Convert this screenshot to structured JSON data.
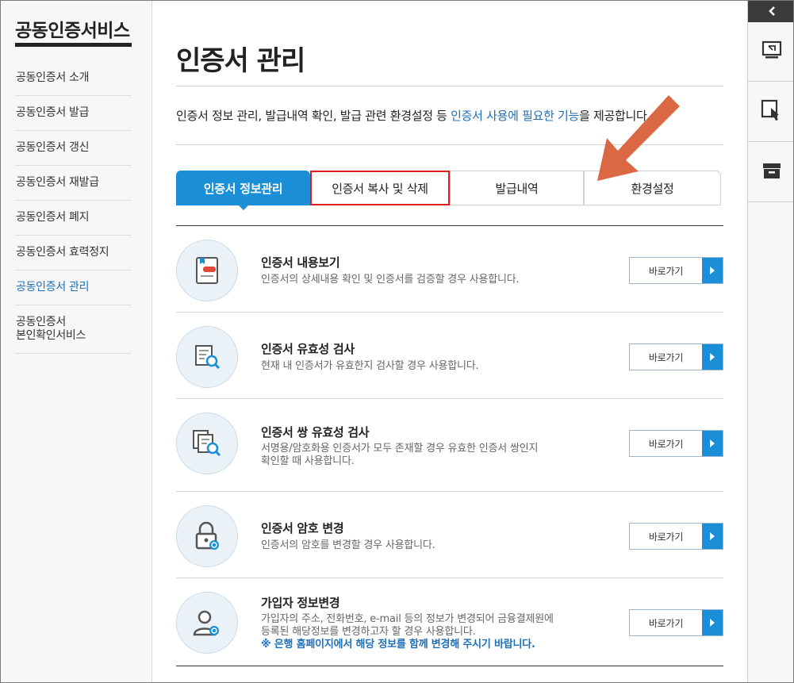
{
  "sidebar": {
    "title": "공동인증서비스",
    "items": [
      {
        "label": "공동인증서 소개",
        "active": false
      },
      {
        "label": "공동인증서 발급",
        "active": false
      },
      {
        "label": "공동인증서 갱신",
        "active": false
      },
      {
        "label": "공동인증서 재발급",
        "active": false
      },
      {
        "label": "공동인증서 폐지",
        "active": false
      },
      {
        "label": "공동인증서 효력정지",
        "active": false
      },
      {
        "label": "공동인증서 관리",
        "active": true
      },
      {
        "label_line1": "공동인증서",
        "label_line2": "본인확인서비스",
        "active": false
      }
    ]
  },
  "main": {
    "title": "인증서 관리",
    "intro": {
      "part1": "인증서 정보 관리, 발급내역 확인, 발급 관련 환경설정 등 ",
      "highlight": "인증서 사용에 필요한 기능",
      "part2": "을 제공합니다."
    },
    "tabs": [
      {
        "label": "인증서 정보관리",
        "active": true
      },
      {
        "label": "인증서 복사 및 삭제",
        "active": false,
        "highlighted": true
      },
      {
        "label": "발급내역",
        "active": false
      },
      {
        "label": "환경설정",
        "active": false
      }
    ],
    "items": [
      {
        "icon": "certificate-view-icon",
        "title": "인증서 내용보기",
        "desc": "인증서의 상세내용 확인 및 인증서를 검증할 경우 사용합니다.",
        "button": "바로가기"
      },
      {
        "icon": "validity-check-icon",
        "title": "인증서 유효성 검사",
        "desc": "현재 내 인증서가 유효한지 검사할 경우 사용합니다.",
        "button": "바로가기"
      },
      {
        "icon": "pair-validity-icon",
        "title": "인증서 쌍 유효성 검사",
        "desc_line1": "서명용/암호화용 인증서가 모두 존재할 경우 유효한 인증서 쌍인지",
        "desc_line2": "확인할 때 사용합니다.",
        "button": "바로가기"
      },
      {
        "icon": "password-lock-icon",
        "title": "인증서 암호 변경",
        "desc": "인증서의 암호를 변경할 경우 사용합니다.",
        "button": "바로가기"
      },
      {
        "icon": "user-info-icon",
        "title": "가입자 정보변경",
        "desc_line1": "가입자의 주소, 전화번호, e-mail 등의 정보가 변경되어 금융결제원에",
        "desc_line2": "등록된 해당정보를 변경하고자 할 경우 사용합니다.",
        "notice": "※ 은행 홈페이지에서 해당 정보를 함께 변경해 주시기 바랍니다.",
        "button": "바로가기"
      }
    ]
  },
  "colors": {
    "accent": "#1a8fd8",
    "link": "#1f6fb8",
    "highlight_box": "#e02020",
    "annotation_arrow": "#d9603b"
  }
}
